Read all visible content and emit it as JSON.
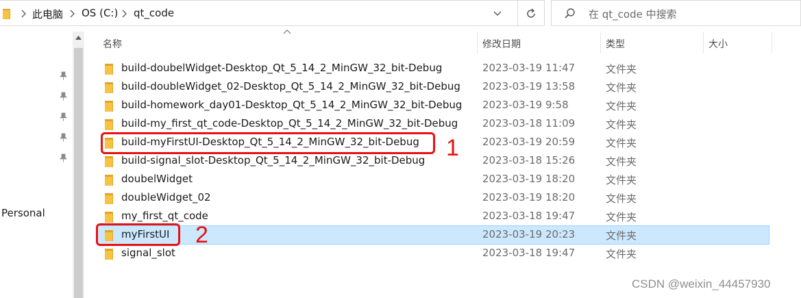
{
  "address_bar": {
    "crumbs": [
      "此电脑",
      "OS (C:)",
      "qt_code"
    ]
  },
  "search": {
    "placeholder": "在 qt_code 中搜索"
  },
  "nav": {
    "personal_label": "Personal"
  },
  "columns": {
    "name": "名称",
    "date": "修改日期",
    "type": "类型",
    "size": "大小"
  },
  "files": [
    {
      "name": "build-doubelWidget-Desktop_Qt_5_14_2_MinGW_32_bit-Debug",
      "date": "2023-03-19 11:47",
      "type": "文件夹"
    },
    {
      "name": "build-doubleWidget_02-Desktop_Qt_5_14_2_MinGW_32_bit-Debug",
      "date": "2023-03-19 13:58",
      "type": "文件夹"
    },
    {
      "name": "build-homework_day01-Desktop_Qt_5_14_2_MinGW_32_bit-Debug",
      "date": "2023-03-19 9:58",
      "type": "文件夹"
    },
    {
      "name": "build-my_first_qt_code-Desktop_Qt_5_14_2_MinGW_32_bit-Debug",
      "date": "2023-03-18 11:09",
      "type": "文件夹"
    },
    {
      "name": "build-myFirstUI-Desktop_Qt_5_14_2_MinGW_32_bit-Debug",
      "date": "2023-03-19 20:59",
      "type": "文件夹"
    },
    {
      "name": "build-signal_slot-Desktop_Qt_5_14_2_MinGW_32_bit-Debug",
      "date": "2023-03-18 15:26",
      "type": "文件夹"
    },
    {
      "name": "doubelWidget",
      "date": "2023-03-19 18:20",
      "type": "文件夹"
    },
    {
      "name": "doubleWidget_02",
      "date": "2023-03-19 18:20",
      "type": "文件夹"
    },
    {
      "name": "my_first_qt_code",
      "date": "2023-03-18 19:47",
      "type": "文件夹"
    },
    {
      "name": "myFirstUI",
      "date": "2023-03-19 20:23",
      "type": "文件夹",
      "selected": true
    },
    {
      "name": "signal_slot",
      "date": "2023-03-18 19:47",
      "type": "文件夹"
    }
  ],
  "annotations": {
    "label_1": "1",
    "label_2": "2"
  },
  "watermark": "CSDN @weixin_44457930",
  "colors": {
    "selection": "#cce8ff",
    "annotation_red": "#e81010",
    "folder": "#f6c344"
  }
}
